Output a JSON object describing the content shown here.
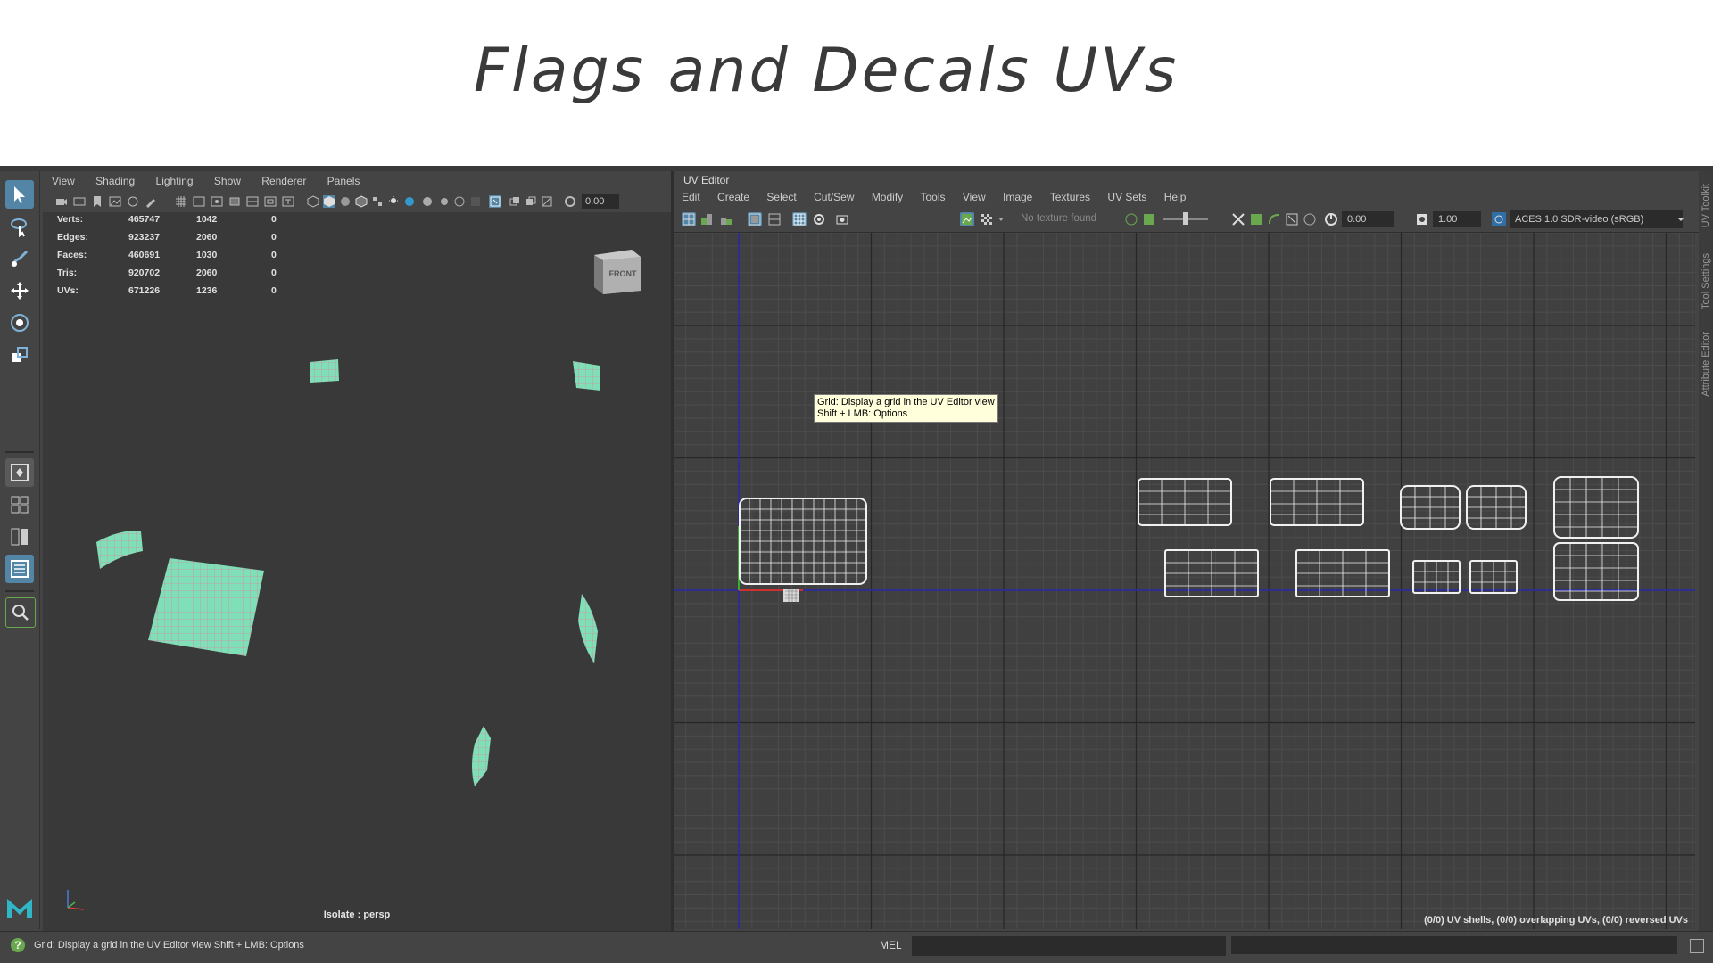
{
  "slide": {
    "title": "Flags and Decals UVs"
  },
  "viewport": {
    "menu": [
      "View",
      "Shading",
      "Lighting",
      "Show",
      "Renderer",
      "Panels"
    ],
    "field_value": "0.00",
    "hud": [
      {
        "label": "Verts:",
        "total": "465747",
        "selected": "1042",
        "extra": "0"
      },
      {
        "label": "Edges:",
        "total": "923237",
        "selected": "2060",
        "extra": "0"
      },
      {
        "label": "Faces:",
        "total": "460691",
        "selected": "1030",
        "extra": "0"
      },
      {
        "label": "Tris:",
        "total": "920702",
        "selected": "2060",
        "extra": "0"
      },
      {
        "label": "UVs:",
        "total": "671226",
        "selected": "1236",
        "extra": "0"
      }
    ],
    "viewcube_label": "FRONT",
    "isolate_label": "Isolate : persp"
  },
  "uv_editor": {
    "title": "UV Editor",
    "menu": [
      "Edit",
      "Create",
      "Select",
      "Cut/Sew",
      "Modify",
      "Tools",
      "View",
      "Image",
      "Textures",
      "UV Sets",
      "Help"
    ],
    "no_texture": "No texture found",
    "exposure": "0.00",
    "gamma": "1.00",
    "color_space": "ACES 1.0 SDR-video (sRGB)",
    "tooltip_line1": "Grid: Display a grid in the UV Editor view",
    "tooltip_line2": "Shift + LMB: Options",
    "stats": "(0/0) UV shells, (0/0) overlapping UVs, (0/0) reversed UVs"
  },
  "side_tabs": [
    "UV Toolkit",
    "Tool Settings",
    "Attribute Editor"
  ],
  "statusbar": {
    "help_text": "Grid: Display a grid in the UV Editor view Shift + LMB: Options",
    "mel_label": "MEL"
  },
  "colors": {
    "accent": "#5285a6",
    "mesh_green": "#7fe0b8",
    "uv_wire": "#f0f0f0"
  }
}
